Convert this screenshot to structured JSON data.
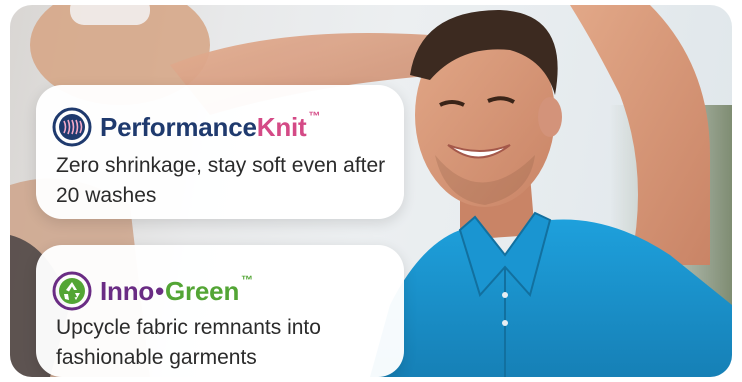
{
  "features": [
    {
      "brand_part1": "Performance",
      "brand_part2": "Knit",
      "trademark": "™",
      "icon": "knit-yarn-icon",
      "description": "Zero shrinkage, stay soft even after 20 washes",
      "colors": {
        "part1": "#1f3a6e",
        "part2": "#d44a86"
      }
    },
    {
      "brand_part1": "Inno",
      "brand_separator": "•",
      "brand_part2": "Green",
      "trademark": "™",
      "icon": "recycle-icon",
      "description": "Upcycle fabric remnants into fashionable garments",
      "colors": {
        "part1": "#6a2c84",
        "part2": "#53a535"
      }
    }
  ],
  "photo": {
    "subject": "smiling-man-blue-polo-icon",
    "shirt_color": "#1b8fc9"
  }
}
